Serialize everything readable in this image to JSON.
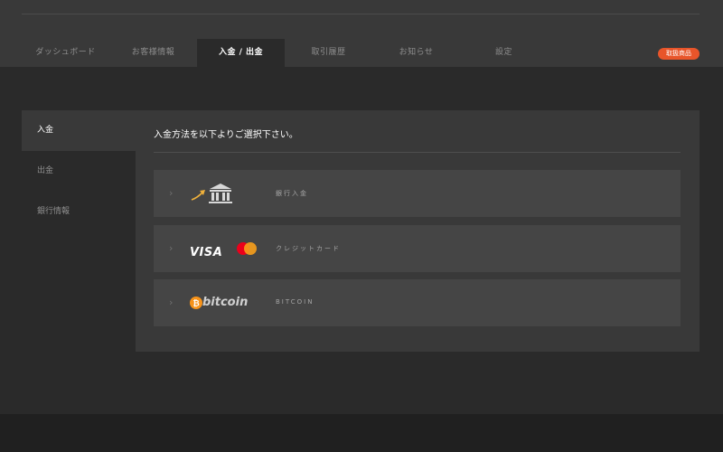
{
  "nav": {
    "tabs": [
      {
        "label": "ダッシュボード"
      },
      {
        "label": "お客様情報"
      },
      {
        "label": "入金 / 出金"
      },
      {
        "label": "取引履歴"
      },
      {
        "label": "お知らせ"
      },
      {
        "label": "設定"
      }
    ],
    "active_index": 2,
    "badge": "取扱商品"
  },
  "sidebar": {
    "items": [
      {
        "label": "入金"
      },
      {
        "label": "出金"
      },
      {
        "label": "銀行情報"
      }
    ],
    "active_index": 0
  },
  "main": {
    "heading": "入金方法を以下よりご選択下さい。",
    "options": [
      {
        "label": "銀行入金",
        "icon": "bank-icon"
      },
      {
        "label": "クレジットカード",
        "icon": "visa-mastercard-logo",
        "visa_text": "VISA"
      },
      {
        "label": "BITCOIN",
        "icon": "bitcoin-logo",
        "logo_text": "bitcoin"
      }
    ]
  },
  "colors": {
    "accent": "#e8552a",
    "background": "#2a2a2a",
    "panel": "#393939",
    "option": "#454545"
  }
}
